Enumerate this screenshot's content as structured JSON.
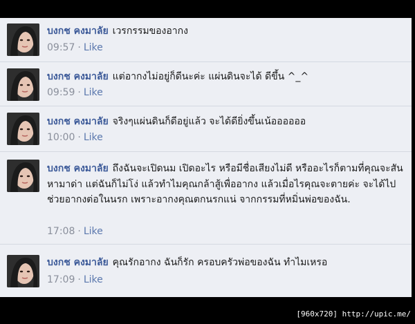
{
  "comments": [
    {
      "author": "บงกช คงมาลัย",
      "text": "เวรกรรมของอากง",
      "time": "09:57",
      "like": "Like"
    },
    {
      "author": "บงกช คงมาลัย",
      "text": "แต่อากงไม่อยู่ก็ดีนะค่ะ แผ่นดินจะได้ ดีขึ้น ^_^",
      "time": "09:59",
      "like": "Like"
    },
    {
      "author": "บงกช คงมาลัย",
      "text": "จริงๆแผ่นดินก็ดีอยู่แล้ว จะได้ดียิ่งขึ้นเน้ออออออ",
      "time": "10:00",
      "like": "Like"
    },
    {
      "author": "บงกช คงมาลัย",
      "text": "ถึงฉันจะเปิดนม เปิดอะไร หรือมีชื่อเสียงไม่ดี หรืออะไรก็ตามที่คุณจะสันหามาด่า แต่ฉันก็ไม่โง่ แล้วทำไมคุณกล้าสู้เพื่ออากง แล้วเมื่อไรคุณจะตายค่ะ จะได้ไปช่วยอากงต่อในนรก เพราะอากงคุณตกนรกแน่ จากกรรมที่หมิ่นพ่อของฉัน.",
      "time": "17:08",
      "like": "Like"
    },
    {
      "author": "บงกช คงมาลัย",
      "text": "คุณรักอากง ฉันก็รัก ครอบครัวพ่อของฉัน ทำไมเหรอ",
      "time": "17:09",
      "like": "Like"
    }
  ],
  "meta_separator": "·",
  "watermark": "[960x720] http://upic.me/"
}
